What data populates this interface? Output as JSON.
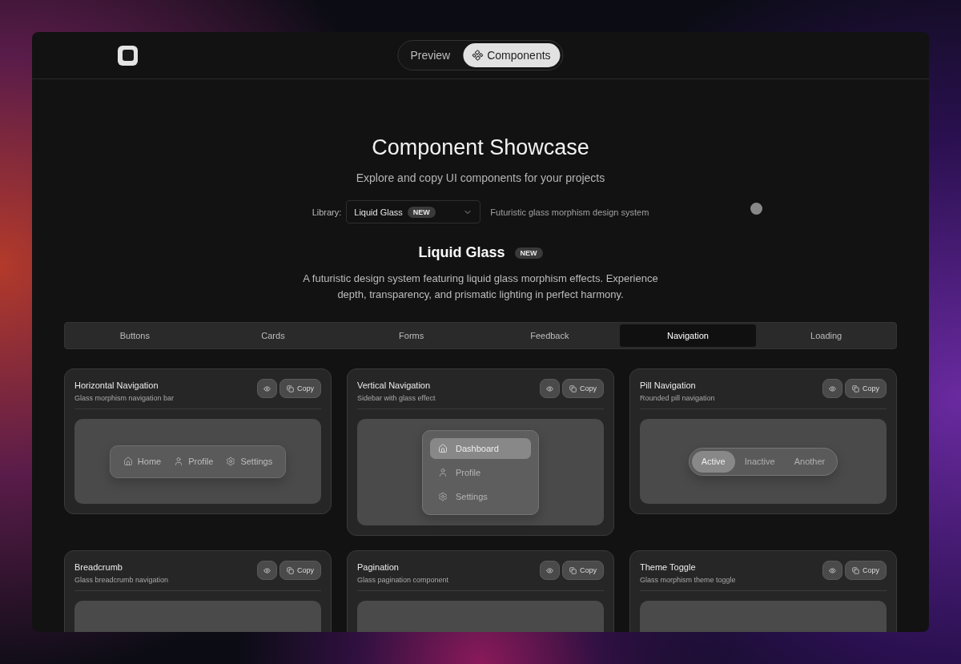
{
  "header": {
    "view_toggle": [
      {
        "label": "Preview",
        "selected": false
      },
      {
        "label": "Components",
        "selected": true
      }
    ]
  },
  "hero": {
    "title": "Component Showcase",
    "subtitle": "Explore and copy UI components for your projects"
  },
  "library": {
    "label": "Library:",
    "value": "Liquid Glass",
    "badge": "NEW",
    "description": "Futuristic glass morphism design system"
  },
  "library_heading": {
    "title": "Liquid Glass",
    "badge": "NEW",
    "description": "A futuristic design system featuring liquid glass morphism effects. Experience depth, transparency, and prismatic lighting in perfect harmony."
  },
  "category_tabs": [
    {
      "label": "Buttons",
      "selected": false
    },
    {
      "label": "Cards",
      "selected": false
    },
    {
      "label": "Forms",
      "selected": false
    },
    {
      "label": "Feedback",
      "selected": false
    },
    {
      "label": "Navigation",
      "selected": true
    },
    {
      "label": "Loading",
      "selected": false
    }
  ],
  "cards": [
    {
      "title": "Horizontal Navigation",
      "description": "Glass morphism navigation bar",
      "copy_label": "Copy",
      "kind": "horizontal",
      "items": [
        {
          "label": "Home"
        },
        {
          "label": "Profile"
        },
        {
          "label": "Settings"
        }
      ]
    },
    {
      "title": "Vertical Navigation",
      "description": "Sidebar with glass effect",
      "copy_label": "Copy",
      "kind": "vertical",
      "items": [
        {
          "label": "Dashboard",
          "selected": true
        },
        {
          "label": "Profile",
          "selected": false
        },
        {
          "label": "Settings",
          "selected": false
        }
      ]
    },
    {
      "title": "Pill Navigation",
      "description": "Rounded pill navigation",
      "copy_label": "Copy",
      "kind": "pill",
      "items": [
        {
          "label": "Active",
          "selected": true
        },
        {
          "label": "Inactive",
          "selected": false
        },
        {
          "label": "Another",
          "selected": false
        }
      ]
    },
    {
      "title": "Breadcrumb",
      "description": "Glass breadcrumb navigation",
      "copy_label": "Copy",
      "kind": "empty"
    },
    {
      "title": "Pagination",
      "description": "Glass pagination component",
      "copy_label": "Copy",
      "kind": "empty"
    },
    {
      "title": "Theme Toggle",
      "description": "Glass morphism theme toggle",
      "copy_label": "Copy",
      "kind": "empty"
    }
  ]
}
